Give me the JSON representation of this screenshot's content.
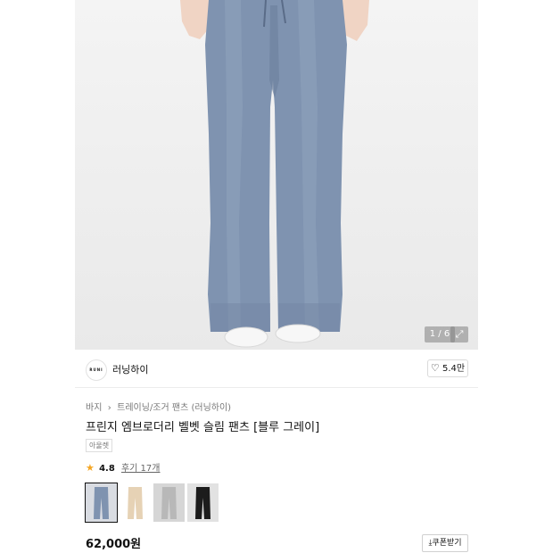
{
  "hero": {
    "image_alt": "Blue gray velvet slim pants worn by model",
    "counter": "1 / 6",
    "expand_icon": "expand-icon"
  },
  "store": {
    "logo_text": "RUNI",
    "name": "러닝하이",
    "likes": "5.4만"
  },
  "breadcrumb": [
    "바지",
    "트레이닝/조거 팬츠 (러닝하이)"
  ],
  "product": {
    "title": "프린지 엠브로더리 벨벳 슬림 팬츠 [블루 그레이]",
    "badge": "아울렛",
    "rating": "4.8",
    "review_label": "후기 17개",
    "price": "62,000원",
    "coupon_label": "쿠폰받기",
    "thumbnails": [
      {
        "color": "blue-gray",
        "fill": "#7f93b0"
      },
      {
        "color": "beige",
        "fill": "#e6d2b5"
      },
      {
        "color": "light-gray",
        "fill": "#c6c6c6"
      },
      {
        "color": "black",
        "fill": "#1c1c1c"
      }
    ]
  }
}
